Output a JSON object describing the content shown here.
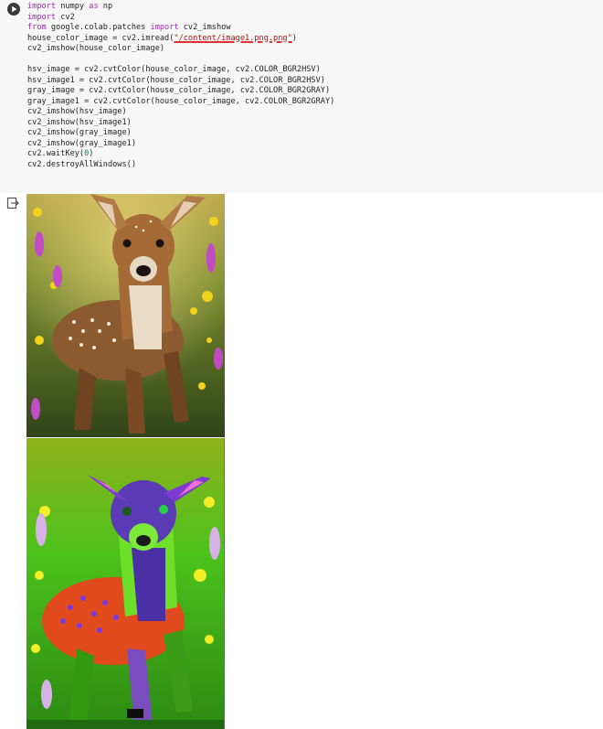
{
  "cell": {
    "run_button": "play-icon",
    "lines": [
      {
        "parts": [
          [
            "kw",
            "import"
          ],
          [
            "fn",
            " numpy "
          ],
          [
            "kw",
            "as"
          ],
          [
            "fn",
            " np"
          ]
        ]
      },
      {
        "parts": [
          [
            "kw",
            "import"
          ],
          [
            "fn",
            " cv2"
          ]
        ]
      },
      {
        "parts": [
          [
            "kw",
            "from"
          ],
          [
            "fn",
            " google.colab.patches "
          ],
          [
            "kw",
            "import"
          ],
          [
            "fn",
            " cv2_imshow"
          ]
        ]
      },
      {
        "parts": [
          [
            "fn",
            "house_color_image = cv2.imread("
          ],
          [
            "str",
            "\"/content/image1.png.png\""
          ],
          [
            "fn",
            ")"
          ]
        ]
      },
      {
        "parts": [
          [
            "fn",
            "cv2_imshow(house_color_image)"
          ]
        ]
      },
      {
        "parts": [
          [
            "fn",
            ""
          ]
        ]
      },
      {
        "parts": [
          [
            "fn",
            "hsv_image = cv2.cvtColor(house_color_image, cv2.COLOR_BGR2HSV)"
          ]
        ]
      },
      {
        "parts": [
          [
            "fn",
            "hsv_image1 = cv2.cvtColor(house_color_image, cv2.COLOR_BGR2HSV)"
          ]
        ]
      },
      {
        "parts": [
          [
            "fn",
            "gray_image = cv2.cvtColor(house_color_image, cv2.COLOR_BGR2GRAY)"
          ]
        ]
      },
      {
        "parts": [
          [
            "fn",
            "gray_image1 = cv2.cvtColor(house_color_image, cv2.COLOR_BGR2GRAY)"
          ]
        ]
      },
      {
        "parts": [
          [
            "fn",
            "cv2_imshow(hsv_image)"
          ]
        ]
      },
      {
        "parts": [
          [
            "fn",
            "cv2_imshow(hsv_image1)"
          ]
        ]
      },
      {
        "parts": [
          [
            "fn",
            "cv2_imshow(gray_image)"
          ]
        ]
      },
      {
        "parts": [
          [
            "fn",
            "cv2_imshow(gray_image1)"
          ]
        ]
      },
      {
        "parts": [
          [
            "fn",
            "cv2.waitKey("
          ],
          [
            "num",
            "0"
          ],
          [
            "fn",
            ")"
          ]
        ]
      },
      {
        "parts": [
          [
            "fn",
            "cv2.destroyAllWindows()"
          ]
        ]
      }
    ]
  },
  "output": {
    "output_icon": "output-redirect-icon",
    "images": [
      {
        "name": "fawn-color-image",
        "description_icon": "image"
      },
      {
        "name": "fawn-hsv-image",
        "description_icon": "image"
      }
    ]
  },
  "colors": {
    "keyword": "#9b2bb0",
    "string": "#a31515",
    "number": "#0b7d5a",
    "cell_bg": "#f7f7f7"
  }
}
